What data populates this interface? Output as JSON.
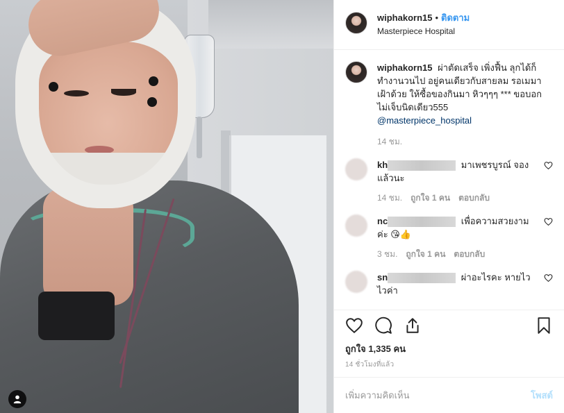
{
  "header": {
    "username": "wiphakorn15",
    "separator": "•",
    "follow_label": "ติดตาม",
    "location": "Masterpiece Hospital"
  },
  "caption": {
    "username": "wiphakorn15",
    "text": "ผ่าตัดเสร็จ เพิ่งฟื้น ลุกได้ก็ทำงานวนไป อยู่คนเดียวกับสายลม รอเมมาเฝ้าด้วย ให้ซื้อของกินมา หิวๆๆๆ *** ขอบอก ไม่เจ็บนิดเดียว555",
    "mention": "@masterpiece_hospital",
    "time": "14 ชม."
  },
  "comments": [
    {
      "user": "kh",
      "text": "มาเพชรบูรณ์ จองแล้วนะ",
      "time": "14 ชม.",
      "likes": "ถูกใจ 1 คน",
      "reply": "ตอบกลับ"
    },
    {
      "user": "nc",
      "text": "เพื่อความสวยงามค่ะ 😘👍",
      "time": "3 ชม.",
      "likes": "ถูกใจ 1 คน",
      "reply": "ตอบกลับ"
    },
    {
      "user": "sn",
      "text": "ผ่าอะไรคะ หายไวไวค่า"
    }
  ],
  "actions": {
    "likes_text": "ถูกใจ 1,335 คน",
    "posted_time": "14 ชั่วโมงที่แล้ว"
  },
  "composer": {
    "placeholder": "เพิ่มความคิดเห็น",
    "post_label": "โพสต์"
  },
  "icons": {
    "like": "heart-icon",
    "comment": "comment-icon",
    "share": "share-icon",
    "save": "bookmark-icon",
    "user": "user-icon"
  },
  "colors": {
    "accent": "#3897f0",
    "mention": "#003569",
    "muted": "#999999"
  }
}
